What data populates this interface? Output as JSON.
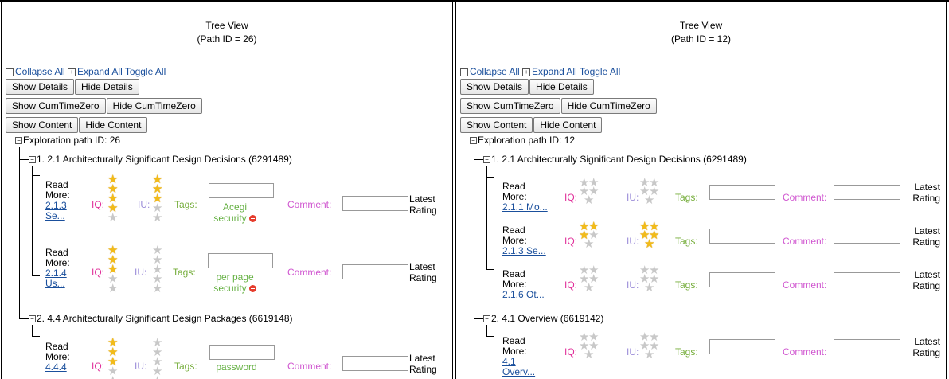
{
  "panes": [
    {
      "title": "Tree View",
      "path_id_label": "(Path ID = 26)",
      "links": {
        "collapse": "Collapse All",
        "expand": "Expand All",
        "toggle": "Toggle All"
      },
      "buttons": {
        "show_details": "Show Details",
        "hide_details": "Hide Details",
        "show_cumtimezero": "Show CumTimeZero",
        "hide_cumtimezero": "Hide CumTimeZero",
        "show_content": "Show Content",
        "hide_content": "Hide Content"
      },
      "root_label": "Exploration path ID: 26",
      "nodes": [
        {
          "label": "1. 2.1 Architecturally Significant Design Decisions (6291489)",
          "leaves": [
            {
              "read_more": "Read More:",
              "link": "2.1.3 Se...",
              "iq": "IQ:",
              "iu": "IU:",
              "tags": "Tags:",
              "tag_value": "Acegi security",
              "comment": "Comment:",
              "latest": "Latest Rating",
              "iq_rating": 4,
              "iu_rating": 3
            },
            {
              "read_more": "Read More:",
              "link": "2.1.4 Us...",
              "iq": "IQ:",
              "iu": "IU:",
              "tags": "Tags:",
              "tag_value": "per page security",
              "comment": "Comment:",
              "latest": "Latest Rating",
              "iq_rating": 3,
              "iu_rating": 0
            }
          ]
        },
        {
          "label": "2. 4.4 Architecturally Significant Design Packages (6619148)",
          "leaves": [
            {
              "read_more": "Read More:",
              "link": "4.4.4",
              "iq": "IQ:",
              "iu": "IU:",
              "tags": "Tags:",
              "tag_value": "password",
              "comment": "Comment:",
              "latest": "Latest Rating",
              "iq_rating": 3,
              "iu_rating": 0
            }
          ]
        }
      ]
    },
    {
      "title": "Tree View",
      "path_id_label": "(Path ID = 12)",
      "links": {
        "collapse": "Collapse All",
        "expand": "Expand All",
        "toggle": "Toggle All"
      },
      "buttons": {
        "show_details": "Show Details",
        "hide_details": "Hide Details",
        "show_cumtimezero": "Show CumTimeZero",
        "hide_cumtimezero": "Hide CumTimeZero",
        "show_content": "Show Content",
        "hide_content": "Hide Content"
      },
      "root_label": "Exploration path ID: 12",
      "nodes": [
        {
          "label": "1. 2.1 Architecturally Significant Design Decisions (6291489)",
          "leaves": [
            {
              "read_more": "Read More:",
              "link": "2.1.1 Mo...",
              "iq": "IQ:",
              "iu": "IU:",
              "tags": "Tags:",
              "comment": "Comment:",
              "latest": "Latest Rating",
              "iq_rating": 0,
              "iu_rating": 0
            },
            {
              "read_more": "Read More:",
              "link": "2.1.3 Se...",
              "iq": "IQ:",
              "iu": "IU:",
              "tags": "Tags:",
              "comment": "Comment:",
              "latest": "Latest Rating",
              "iq_rating": 3,
              "iu_rating": 5
            },
            {
              "read_more": "Read More:",
              "link": "2.1.6 Ot...",
              "iq": "IQ:",
              "iu": "IU:",
              "tags": "Tags:",
              "comment": "Comment:",
              "latest": "Latest Rating",
              "iq_rating": 0,
              "iu_rating": 0
            }
          ]
        },
        {
          "label": "2. 4.1 Overview (6619142)",
          "leaves": [
            {
              "read_more": "Read More:",
              "link": "4.1 Overv...",
              "iq": "IQ:",
              "iu": "IU:",
              "tags": "Tags:",
              "comment": "Comment:",
              "latest": "Latest Rating",
              "iq_rating": 0,
              "iu_rating": 0
            }
          ]
        }
      ]
    }
  ],
  "colors": {
    "iq": "#e0309a",
    "iu": "#9b8cd8",
    "tags": "#75ad3a",
    "comment": "#d057d0",
    "star_on": "#f2bb18",
    "star_off": "#c8c8c8",
    "link": "#1a4f9c"
  }
}
